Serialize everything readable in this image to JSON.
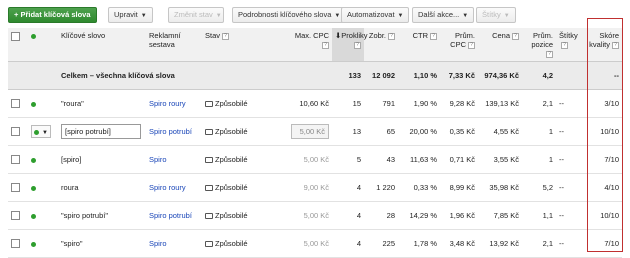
{
  "toolbar": {
    "add_keyword": "Přidat klíčová slova",
    "edit": "Upravit",
    "change_status": "Změnit stav",
    "details": "Podrobnosti klíčového slova",
    "automate": "Automatizovat",
    "more_actions": "Další akce...",
    "labels": "Štítky"
  },
  "columns": {
    "keyword": "Klíčové slovo",
    "adgroup": "Reklamní sestava",
    "status": "Stav",
    "max_cpc": "Max. CPC",
    "clicks": "Prokliky",
    "impr": "Zobr.",
    "ctr": "CTR",
    "avg_cpc": "Prům. CPC",
    "cost": "Cena",
    "avg_pos": "Prům. pozice",
    "labels": "Štítky",
    "quality": "Skóre kvality"
  },
  "total": {
    "label": "Celkem – všechna klíčová slova",
    "clicks": "133",
    "impr": "12 092",
    "ctr": "1,10 %",
    "avg_cpc": "7,33 Kč",
    "cost": "974,36 Kč",
    "avg_pos": "4,2",
    "labels": "",
    "quality": "--"
  },
  "rows": [
    {
      "keyword": "\"roura\"",
      "adgroup": "Spiro roury",
      "status": "Způsobilé",
      "max_cpc": "10,60 Kč",
      "clicks": "15",
      "impr": "791",
      "ctr": "1,90 %",
      "avg_cpc": "9,28 Kč",
      "cost": "139,13 Kč",
      "avg_pos": "2,1",
      "labels": "--",
      "quality": "3/10",
      "editing": false,
      "cpc_boxed": true
    },
    {
      "keyword": "[spiro potrubí]",
      "adgroup": "Spiro potrubí",
      "status": "Způsobilé",
      "max_cpc": "5,00 Kč",
      "clicks": "13",
      "impr": "65",
      "ctr": "20,00 %",
      "avg_cpc": "0,35 Kč",
      "cost": "4,55 Kč",
      "avg_pos": "1",
      "labels": "--",
      "quality": "10/10",
      "editing": true,
      "cpc_boxed": true
    },
    {
      "keyword": "[spiro]",
      "adgroup": "Spiro",
      "status": "Způsobilé",
      "max_cpc": "5,00 Kč",
      "clicks": "5",
      "impr": "43",
      "ctr": "11,63 %",
      "avg_cpc": "0,71 Kč",
      "cost": "3,55 Kč",
      "avg_pos": "1",
      "labels": "--",
      "quality": "7/10",
      "editing": false,
      "cpc_boxed": false
    },
    {
      "keyword": "roura",
      "adgroup": "Spiro roury",
      "status": "Způsobilé",
      "max_cpc": "9,00 Kč",
      "clicks": "4",
      "impr": "1 220",
      "ctr": "0,33 %",
      "avg_cpc": "8,99 Kč",
      "cost": "35,98 Kč",
      "avg_pos": "5,2",
      "labels": "--",
      "quality": "4/10",
      "editing": false,
      "cpc_boxed": false
    },
    {
      "keyword": "\"spiro potrubí\"",
      "adgroup": "Spiro potrubí",
      "status": "Způsobilé",
      "max_cpc": "5,00 Kč",
      "clicks": "4",
      "impr": "28",
      "ctr": "14,29 %",
      "avg_cpc": "1,96 Kč",
      "cost": "7,85 Kč",
      "avg_pos": "1,1",
      "labels": "--",
      "quality": "10/10",
      "editing": false,
      "cpc_boxed": false
    },
    {
      "keyword": "\"spiro\"",
      "adgroup": "Spiro",
      "status": "Způsobilé",
      "max_cpc": "5,00 Kč",
      "clicks": "4",
      "impr": "225",
      "ctr": "1,78 %",
      "avg_cpc": "3,48 Kč",
      "cost": "13,92 Kč",
      "avg_pos": "2,1",
      "labels": "--",
      "quality": "7/10",
      "editing": false,
      "cpc_boxed": false
    }
  ],
  "colors": {
    "accent_green": "#2e9e2e",
    "link": "#1a46b8",
    "highlight_red": "#c03030"
  },
  "icons": {
    "add": "plus-icon",
    "status": "speech-bubble-icon",
    "dropdown": "caret-down-icon",
    "help": "help-icon"
  }
}
